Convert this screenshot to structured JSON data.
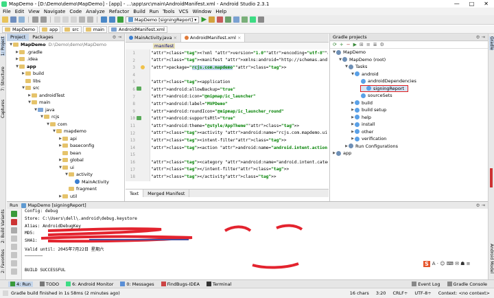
{
  "window": {
    "title": "MapDemo - [D:\\Demo\\demo\\MapDemo] - [app] - ...\\app\\src\\main\\AndroidManifest.xml - Android Studio 2.3.1",
    "minimize": "—",
    "maximize": "□",
    "close": "✕"
  },
  "menu": [
    "File",
    "Edit",
    "View",
    "Navigate",
    "Code",
    "Analyze",
    "Refactor",
    "Build",
    "Run",
    "Tools",
    "VCS",
    "Window",
    "Help"
  ],
  "toolbar": {
    "run_config": "MapDemo [signingReport]"
  },
  "breadcrumbs": [
    "MapDemo",
    "app",
    "src",
    "main",
    "AndroidManifest.xml"
  ],
  "left_strip": [
    "1: Project",
    "7: Structure",
    "Captures",
    "2: Build Variants",
    "2: Favorites"
  ],
  "right_strip": [
    "Gradle",
    "Android Model"
  ],
  "project_panel": {
    "tabs": [
      "Project",
      "Packages"
    ],
    "tree": [
      {
        "label": "MapDemo",
        "extra": "D:\\Demo\\demo\\MapDemo",
        "depth": 0,
        "open": true,
        "bold": true
      },
      {
        "label": ".gradle",
        "depth": 1,
        "open": false
      },
      {
        "label": ".idea",
        "depth": 1,
        "open": false
      },
      {
        "label": "app",
        "depth": 1,
        "open": true,
        "bold": true
      },
      {
        "label": "build",
        "depth": 2,
        "open": false
      },
      {
        "label": "libs",
        "depth": 2,
        "open": false,
        "leaf": true
      },
      {
        "label": "src",
        "depth": 2,
        "open": true
      },
      {
        "label": "androidTest",
        "depth": 3,
        "open": false
      },
      {
        "label": "main",
        "depth": 3,
        "open": true
      },
      {
        "label": "java",
        "depth": 4,
        "open": true,
        "blue": true
      },
      {
        "label": "rcjs",
        "depth": 5,
        "open": true
      },
      {
        "label": "com",
        "depth": 6,
        "open": true
      },
      {
        "label": "mapdemo",
        "depth": 7,
        "open": true
      },
      {
        "label": "api",
        "depth": 8,
        "open": false
      },
      {
        "label": "baseconfig",
        "depth": 8,
        "open": false
      },
      {
        "label": "bean",
        "depth": 8,
        "open": false,
        "leaf": true
      },
      {
        "label": "global",
        "depth": 8,
        "open": false
      },
      {
        "label": "ui",
        "depth": 8,
        "open": true
      },
      {
        "label": "activity",
        "depth": 9,
        "open": true
      },
      {
        "label": "MainActivity",
        "depth": 10,
        "leaf": true,
        "cls": true
      },
      {
        "label": "fragment",
        "depth": 9,
        "leaf": true
      },
      {
        "label": "util",
        "depth": 8,
        "open": false
      }
    ]
  },
  "editor": {
    "tabs": [
      {
        "label": "MainActivity.java",
        "active": false
      },
      {
        "label": "AndroidManifest.xml",
        "active": true
      }
    ],
    "breadcrumb_tag": "manifest",
    "lines": [
      {
        "n": "1",
        "html": "<?xml version=\"1.0\" encoding=\"utf-8\"?>"
      },
      {
        "n": "2",
        "html": "<manifest xmlns:android=\"http://schemas.android.com/apk/res/andro"
      },
      {
        "n": "3",
        "html": "    package=\"rcjs.com.mapdemo\">"
      },
      {
        "n": "4",
        "html": ""
      },
      {
        "n": "5",
        "html": "    <application"
      },
      {
        "n": "6",
        "html": "        android:allowBackup=\"true\""
      },
      {
        "n": "7",
        "html": "        android:icon=\"@mipmap/ic_launcher\""
      },
      {
        "n": "8",
        "html": "        android:label=\"MVPDemo\""
      },
      {
        "n": "9",
        "html": "        android:roundIcon=\"@mipmap/ic_launcher_round\""
      },
      {
        "n": "10",
        "html": "        android:supportsRtl=\"true\""
      },
      {
        "n": "11",
        "html": "        android:theme=\"@style/AppTheme\">"
      },
      {
        "n": "12",
        "html": "        <activity android:name=\"rcjs.com.mapdemo.ui.activity.MainAc"
      },
      {
        "n": "13",
        "html": "            <intent-filter>"
      },
      {
        "n": "14",
        "html": "                <action android:name=\"android.intent.action.MAIN\"/>"
      },
      {
        "n": "15",
        "html": ""
      },
      {
        "n": "16",
        "html": "                <category android:name=\"android.intent.category.LAU"
      },
      {
        "n": "17",
        "html": "            </intent-filter>"
      },
      {
        "n": "18",
        "html": "        </activity>"
      }
    ],
    "bottom_tabs": [
      "Text",
      "Merged Manifest"
    ]
  },
  "gradle_panel": {
    "title": "Gradle projects",
    "tree": [
      {
        "label": "MapDemo",
        "depth": 0,
        "open": true
      },
      {
        "label": "MapDemo (root)",
        "depth": 1,
        "open": true
      },
      {
        "label": "Tasks",
        "depth": 2,
        "open": true
      },
      {
        "label": "android",
        "depth": 3,
        "open": true
      },
      {
        "label": "androidDependencies",
        "depth": 4,
        "leaf": true
      },
      {
        "label": "signingReport",
        "depth": 4,
        "leaf": true,
        "selected": true
      },
      {
        "label": "sourceSets",
        "depth": 4,
        "leaf": true
      },
      {
        "label": "build",
        "depth": 3,
        "open": false
      },
      {
        "label": "build setup",
        "depth": 3,
        "open": false
      },
      {
        "label": "help",
        "depth": 3,
        "open": false
      },
      {
        "label": "install",
        "depth": 3,
        "open": false
      },
      {
        "label": "other",
        "depth": 3,
        "open": false
      },
      {
        "label": "verification",
        "depth": 3,
        "open": false
      },
      {
        "label": "Run Configurations",
        "depth": 2,
        "open": false
      },
      {
        "label": "app",
        "depth": 0,
        "open": false
      }
    ]
  },
  "run_panel": {
    "header": "Run",
    "config": "MapDemo [signingReport]",
    "lines": [
      "Config: debug",
      "Store: C:\\Users\\dell\\.android\\debug.keystore",
      "Alias: AndroidDebugKey",
      "MD5: ",
      "SHA1: ",
      "Valid until: 2045年7月22日 星期六",
      "———————",
      "",
      "BUILD SUCCESSFUL"
    ]
  },
  "tool_windows": [
    {
      "label": "4: Run",
      "color": "#3a9a3a"
    },
    {
      "label": "TODO",
      "color": "#777"
    },
    {
      "label": "6: Android Monitor",
      "color": "#3ddc84"
    },
    {
      "label": "0: Messages",
      "color": "#5a8fd6"
    },
    {
      "label": "FindBugs-IDEA",
      "color": "#c44"
    },
    {
      "label": "Terminal",
      "color": "#333"
    }
  ],
  "tool_windows_right": [
    "Event Log",
    "Gradle Console"
  ],
  "status": {
    "message": "Gradle build finished in 1s 58ms (2 minutes ago)",
    "chars": "16 chars",
    "position": "3:20",
    "line_sep": "CRLF÷",
    "encoding": "UTF-8÷",
    "context": "Context: <no context>"
  }
}
